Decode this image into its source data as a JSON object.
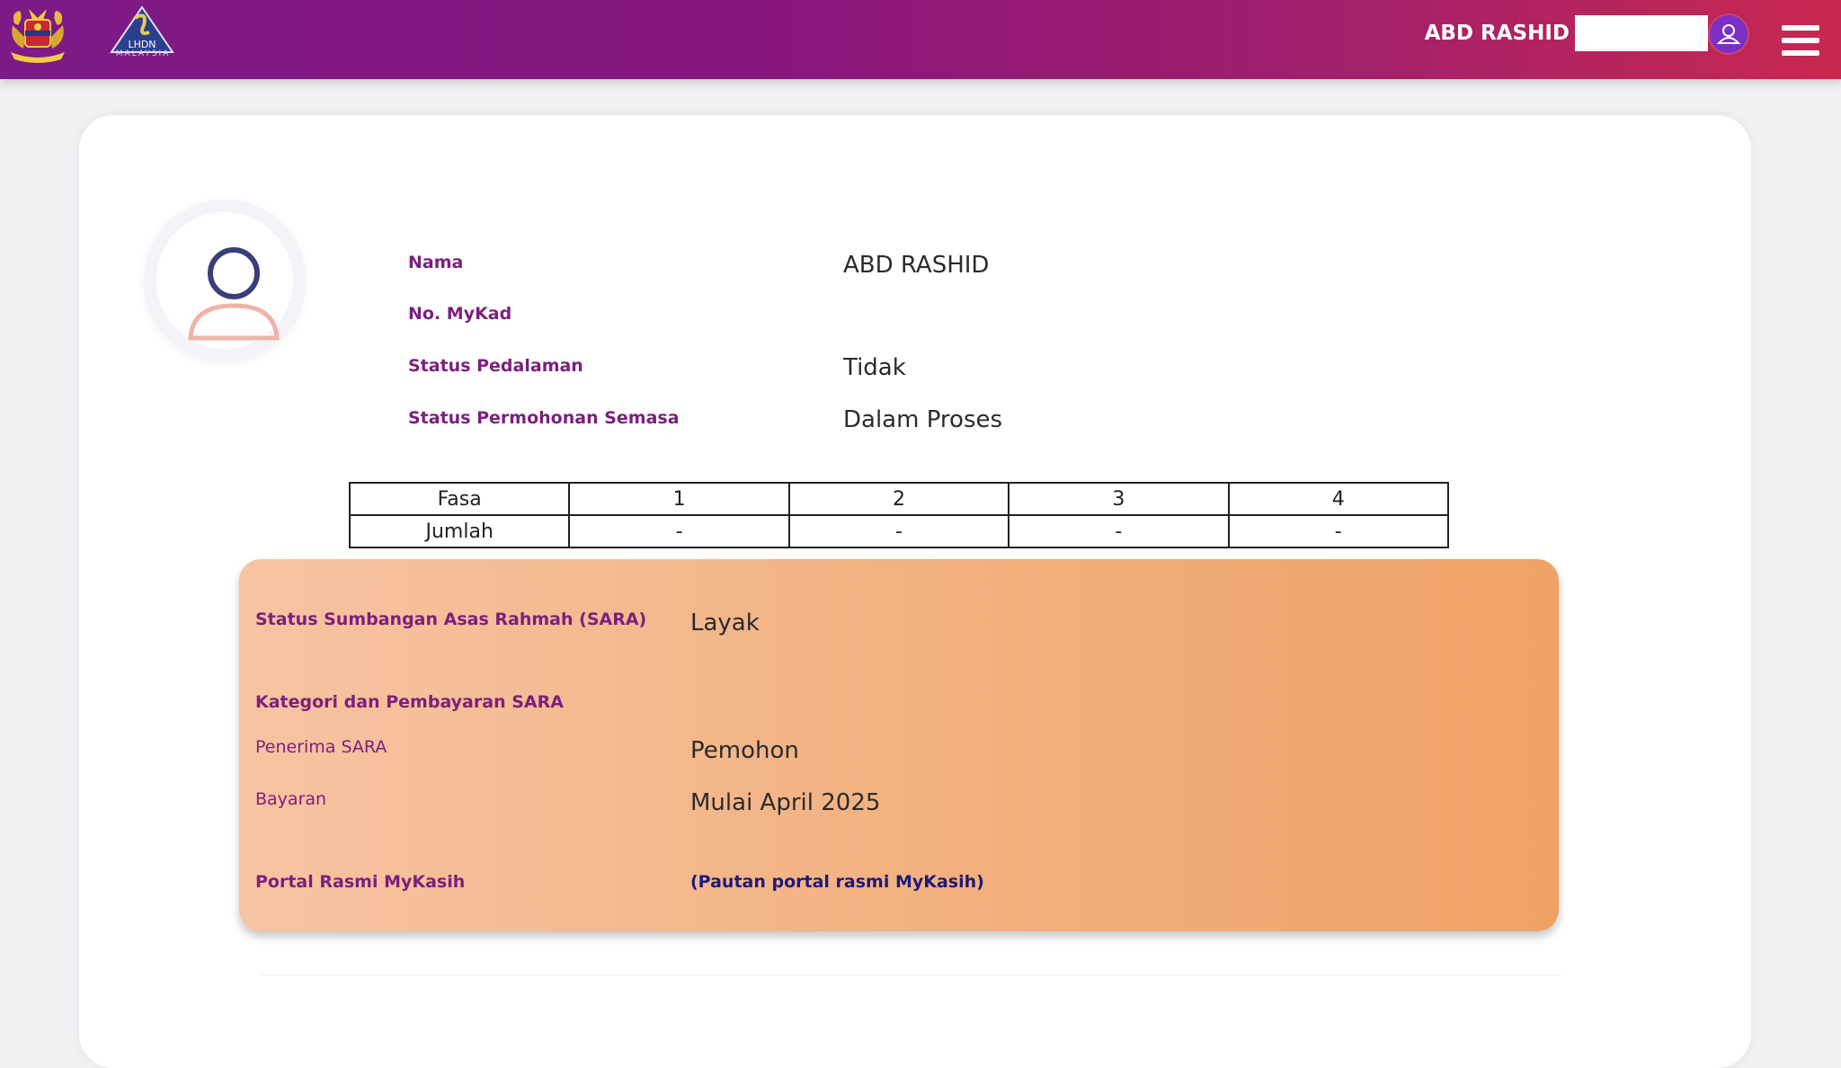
{
  "header": {
    "user_name": "ABD RASHID",
    "logo_text": "LHDN",
    "logo_subtext": "MALAYSIA",
    "colors": {
      "gradient_start": "#7d1a86",
      "gradient_end": "#c8284f",
      "avatar": "#7b2fc7"
    }
  },
  "profile": {
    "fields": [
      {
        "label": "Nama",
        "value": "ABD RASHID"
      },
      {
        "label": "No. MyKad",
        "value": ""
      },
      {
        "label": "Status Pedalaman",
        "value": "Tidak"
      },
      {
        "label": "Status Permohonan Semasa",
        "value": "Dalam Proses"
      }
    ]
  },
  "phase_table": {
    "rows": [
      [
        "Fasa",
        "1",
        "2",
        "3",
        "4"
      ],
      [
        "Jumlah",
        "-",
        "-",
        "-",
        "-"
      ]
    ]
  },
  "sara": {
    "status_label": "Status Sumbangan Asas Rahmah (SARA)",
    "status_value": "Layak",
    "category_heading": "Kategori dan Pembayaran SARA",
    "recipient_label": "Penerima SARA",
    "recipient_value": "Pemohon",
    "payment_label": "Bayaran",
    "payment_value": "Mulai April 2025",
    "portal_label": "Portal Rasmi MyKasih",
    "portal_link": "(Pautan portal rasmi MyKasih)",
    "colors": {
      "label": "#7c1f7e",
      "link": "#1d1a7a"
    }
  },
  "icons": [
    "malaysia-crest-icon",
    "lhdn-logo-icon",
    "user-avatar-icon",
    "hamburger-menu-icon",
    "profile-placeholder-icon"
  ]
}
